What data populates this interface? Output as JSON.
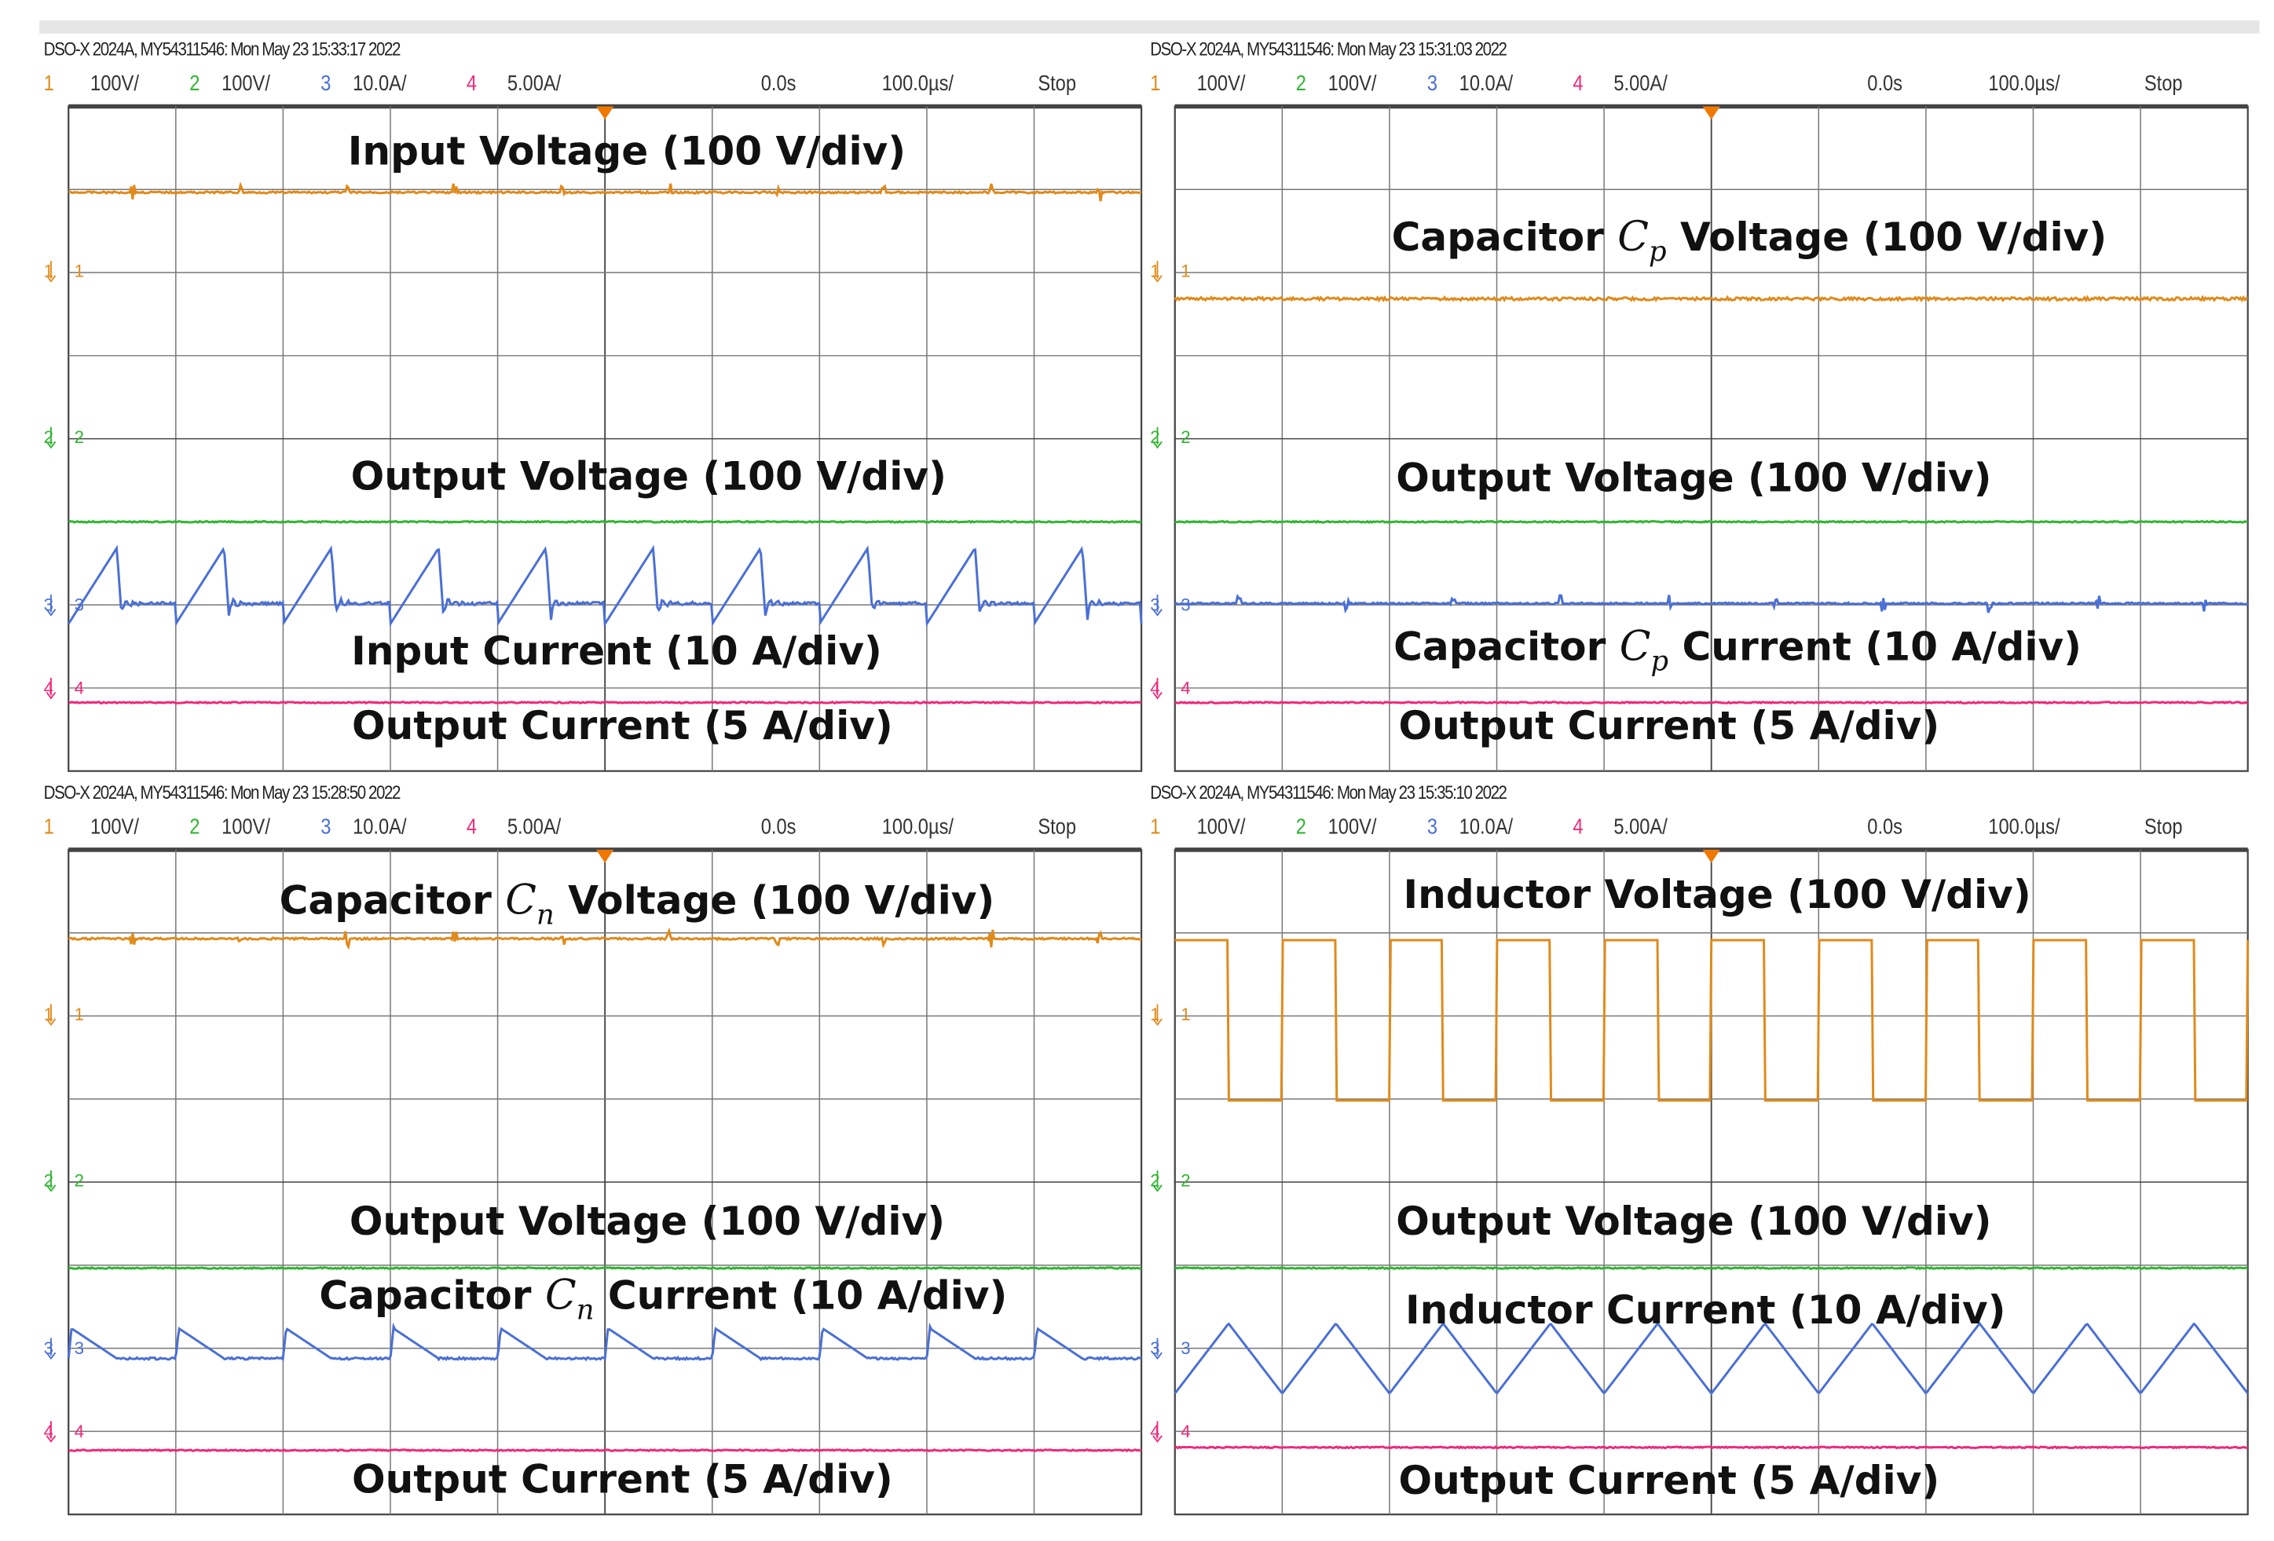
{
  "colors": {
    "ch1": "#e08a1a",
    "ch2": "#2fb52f",
    "ch3": "#4a6fd6",
    "ch4": "#f0287a",
    "grid": "#555555",
    "triggerMarker": "#f07800"
  },
  "channels": [
    {
      "num": "1",
      "scale": "100V/"
    },
    {
      "num": "2",
      "scale": "100V/"
    },
    {
      "num": "3",
      "scale": "10.0A/"
    },
    {
      "num": "4",
      "scale": "5.00A/"
    }
  ],
  "chart_data": [
    {
      "type": "line",
      "id": "tl",
      "header": "DSO-X 2024A, MY54311546: Mon May 23 15:33:17 2022",
      "delay": "0.0s",
      "timebase": "100.0µs/",
      "status": "Stop",
      "traces": {
        "ch1": "flat-spikes",
        "ch2": "flat",
        "ch3": "sawtooth",
        "ch4": "flat"
      },
      "labels": [
        {
          "pre": "Input Voltage (100 V/div)"
        },
        {
          "pre": "Output Voltage (100 V/div)"
        },
        {
          "pre": "Input Current (10 A/div)"
        },
        {
          "pre": "Output Current (5 A/div)"
        }
      ]
    },
    {
      "type": "line",
      "id": "tr",
      "header": "DSO-X 2024A, MY54311546: Mon May 23 15:31:03 2022",
      "delay": "0.0s",
      "timebase": "100.0µs/",
      "status": "Stop",
      "traces": {
        "ch1": "flat-noisy",
        "ch2": "flat",
        "ch3": "flat-spikes",
        "ch4": "flat"
      },
      "labels": [
        {
          "pre": "Capacitor ",
          "math": "C",
          "sub": "p",
          "post": " Voltage (100 V/div)"
        },
        {
          "pre": "Output Voltage (100 V/div)"
        },
        {
          "pre": "Capacitor ",
          "math": "C",
          "sub": "p",
          "post": " Current (10 A/div)"
        },
        {
          "pre": "Output Current (5 A/div)"
        }
      ]
    },
    {
      "type": "line",
      "id": "bl",
      "header": "DSO-X 2024A, MY54311546: Mon May 23 15:28:50 2022",
      "delay": "0.0s",
      "timebase": "100.0µs/",
      "status": "Stop",
      "traces": {
        "ch1": "flat-spikes",
        "ch2": "flat",
        "ch3": "decay-bumps",
        "ch4": "flat"
      },
      "labels": [
        {
          "pre": "Capacitor ",
          "math": "C",
          "sub": "n",
          "post": " Voltage (100 V/div)"
        },
        {
          "pre": "Output Voltage (100 V/div)"
        },
        {
          "pre": "Capacitor ",
          "math": "C",
          "sub": "n",
          "post": " Current (10 A/div)"
        },
        {
          "pre": "Output Current (5 A/div)"
        }
      ]
    },
    {
      "type": "line",
      "id": "br",
      "header": "DSO-X 2024A, MY54311546: Mon May 23 15:35:10 2022",
      "delay": "0.0s",
      "timebase": "100.0µs/",
      "status": "Stop",
      "traces": {
        "ch1": "square",
        "ch2": "flat",
        "ch3": "triangle",
        "ch4": "flat"
      },
      "labels": [
        {
          "pre": "Inductor Voltage (100 V/div)"
        },
        {
          "pre": "Output Voltage (100 V/div)"
        },
        {
          "pre": "Inductor Current (10 A/div)"
        },
        {
          "pre": "Output Current (5 A/div)"
        }
      ]
    }
  ]
}
